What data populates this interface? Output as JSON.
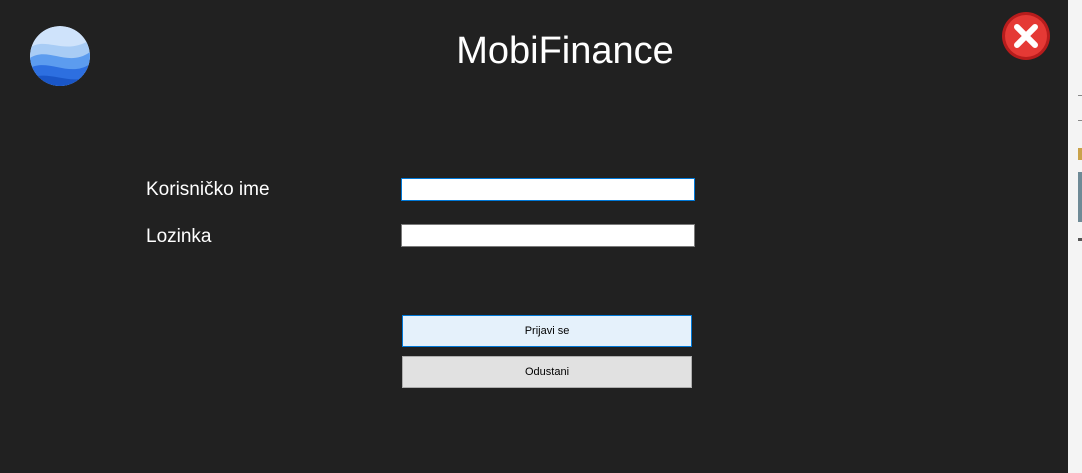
{
  "app": {
    "title": "MobiFinance"
  },
  "form": {
    "username_label": "Korisničko ime",
    "username_value": "",
    "password_label": "Lozinka",
    "password_value": "",
    "login_button": "Prijavi se",
    "cancel_button": "Odustani"
  },
  "icons": {
    "logo": "globe-logo-icon",
    "close": "close-icon"
  },
  "colors": {
    "background": "#212121",
    "text": "#ffffff",
    "focus_border": "#0078d7",
    "close_red": "#d32f2f"
  }
}
